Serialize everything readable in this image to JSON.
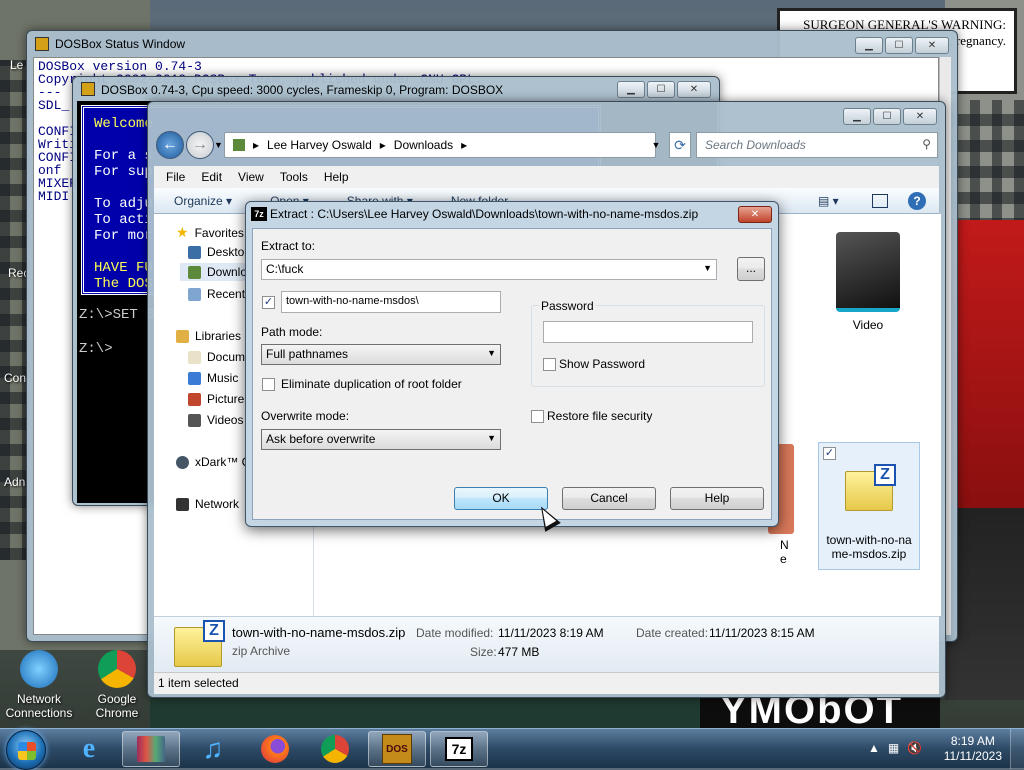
{
  "desktop": {
    "sign_text": "SURGEON GENERAL'S WARNING: Smoking Disease, regnancy.",
    "bottom_sign": "YMObOT",
    "icons": [
      {
        "label": "Network Connections"
      },
      {
        "label": "Google Chrome"
      }
    ],
    "left_edge_labels": [
      "Le",
      "Rec",
      "Con",
      "Adn"
    ]
  },
  "dosbox_status": {
    "title": "DOSBox Status Window",
    "lines": [
      "DOSBox version 0.74-3",
      "Copyright 2002-2019 DOSBox Team, published under GNU GPL.",
      "---",
      "SDL_",
      "",
      "CONFI",
      "Writi",
      "CONFI",
      "onf",
      "MIXER",
      "MIDI:"
    ]
  },
  "dosbox_console": {
    "title": "DOSBox 0.74-3, Cpu speed:   3000 cycles, Frameskip  0, Program:  DOSBOX",
    "banner": [
      "Welcome",
      "",
      "For a s",
      "For sup",
      "",
      "To adju",
      "To acti",
      "For mor",
      "",
      "HAVE FU",
      "The DOS"
    ],
    "prompt1": "Z:\\>SET B",
    "prompt2": "Z:\\>"
  },
  "explorer": {
    "breadcrumb": [
      "Lee Harvey Oswald",
      "Downloads"
    ],
    "search_placeholder": "Search Downloads",
    "menu": [
      "File",
      "Edit",
      "View",
      "Tools",
      "Help"
    ],
    "commands": {
      "organize": "Organize",
      "open": "Open",
      "share": "Share with",
      "new_folder": "New folder"
    },
    "nav": {
      "favorites": "Favorites",
      "desktop": "Desktop",
      "downloads": "Downloads",
      "recent": "Recent",
      "libraries": "Libraries",
      "documents": "Documents",
      "music": "Music",
      "pictures": "Pictures",
      "videos": "Videos",
      "xdark": "xDark™ C",
      "network": "Network"
    },
    "files": [
      {
        "name": "Video"
      },
      {
        "name": "town-with-no-name-msdos.zip"
      }
    ],
    "partial_file_letters": "N\ne",
    "details": {
      "name": "town-with-no-name-msdos.zip",
      "type": "zip Archive",
      "modified_label": "Date modified:",
      "modified_value": "11/11/2023 8:19 AM",
      "size_label": "Size:",
      "size_value": "477 MB",
      "created_label": "Date created:",
      "created_value": "11/11/2023 8:15 AM"
    },
    "status": "1 item selected"
  },
  "extract_dialog": {
    "title": "Extract : C:\\Users\\Lee Harvey Oswald\\Downloads\\town-with-no-name-msdos.zip",
    "extract_to_label": "Extract to:",
    "extract_to_value": "C:\\fuck",
    "browse_label": "...",
    "subfolder_value": "town-with-no-name-msdos\\",
    "subfolder_checked": true,
    "path_mode_label": "Path mode:",
    "path_mode_value": "Full pathnames",
    "eliminate_label": "Eliminate duplication of root folder",
    "overwrite_label": "Overwrite mode:",
    "overwrite_value": "Ask before overwrite",
    "password_label": "Password",
    "password_value": "",
    "show_password_label": "Show Password",
    "restore_security_label": "Restore file security",
    "ok_label": "OK",
    "cancel_label": "Cancel",
    "help_label": "Help"
  },
  "taskbar": {
    "time": "8:19 AM",
    "date": "11/11/2023",
    "dos_icon_text": "DOS",
    "sevenzip_icon_text": "7z"
  },
  "colors": {
    "dos_blue": "#0000aa",
    "taskbar": "#2d4a66",
    "accent": "#3c7fb1"
  }
}
